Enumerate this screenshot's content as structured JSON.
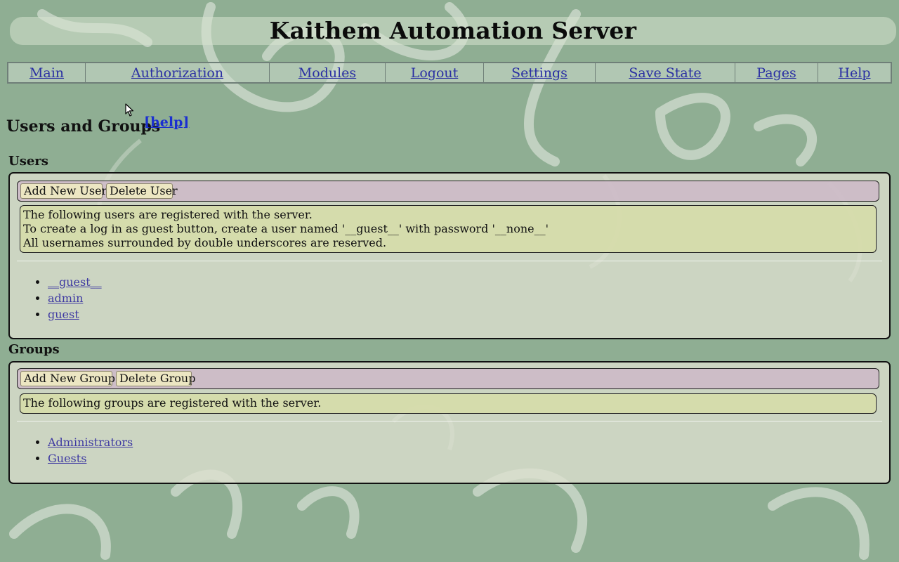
{
  "header": {
    "title": "Kaithem Automation Server"
  },
  "nav": {
    "items": [
      {
        "label": "Main"
      },
      {
        "label": "Authorization"
      },
      {
        "label": "Modules"
      },
      {
        "label": "Logout"
      },
      {
        "label": "Settings"
      },
      {
        "label": "Save State"
      },
      {
        "label": "Pages"
      },
      {
        "label": "Help"
      }
    ]
  },
  "page": {
    "heading": "Users and Groups",
    "help_link": "[help]"
  },
  "users": {
    "section_title": "Users",
    "add_button": "Add New User",
    "delete_button": "Delete User",
    "info_lines": [
      "The following users are registered with the server.",
      "To create a log in as guest button, create a user named '__guest__' with password '__none__'",
      "All usernames surrounded by double underscores are reserved."
    ],
    "list": [
      "__guest__",
      "admin",
      "guest"
    ]
  },
  "groups": {
    "section_title": "Groups",
    "add_button": "Add New Group",
    "delete_button": "Delete Group",
    "info_lines": [
      "The following groups are registered with the server."
    ],
    "list": [
      "Administrators",
      "Guests"
    ]
  },
  "colors": {
    "background": "#8fae93",
    "link": "#2a2fa3",
    "toolbar": "#cdb9c8",
    "info_box": "#d6dcaa",
    "button": "#ece6c2"
  },
  "icons": {
    "cursor": "mouse-pointer-icon",
    "background": "butterfly-pattern"
  }
}
